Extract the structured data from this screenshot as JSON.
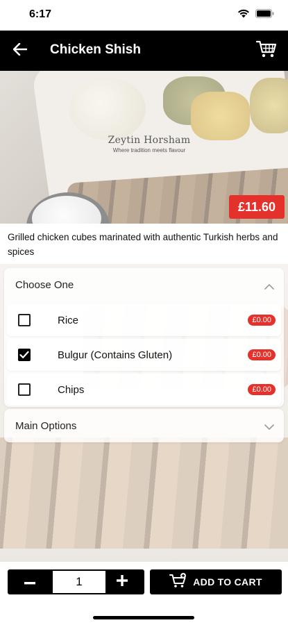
{
  "status_bar": {
    "time": "6:17"
  },
  "header": {
    "title": "Chicken Shish"
  },
  "hero": {
    "watermark_name": "Zeytin Horsham",
    "watermark_tagline": "Where tradition meets flavour",
    "price": "£11.60"
  },
  "description": "Grilled chicken cubes marinated with authentic Turkish herbs and spices",
  "choose_one": {
    "title": "Choose One",
    "expanded": true,
    "options": [
      {
        "label": "Rice",
        "price": "£0.00",
        "checked": false
      },
      {
        "label": "Bulgur (Contains Gluten)",
        "price": "£0.00",
        "checked": true
      },
      {
        "label": "Chips",
        "price": "£0.00",
        "checked": false
      }
    ]
  },
  "main_options": {
    "title": "Main Options",
    "expanded": false
  },
  "footer": {
    "quantity": "1",
    "add_to_cart_label": "ADD TO CART"
  },
  "icons": {
    "back": "arrow-left-icon",
    "cart": "shopping-cart-icon",
    "chevron_up": "chevron-up-icon",
    "chevron_down": "chevron-down-icon",
    "minus": "minus-icon",
    "plus": "plus-icon",
    "add_cart": "cart-add-icon"
  },
  "colors": {
    "header_bg": "#000000",
    "price_badge": "#e4312b",
    "button_bg": "#000000"
  }
}
